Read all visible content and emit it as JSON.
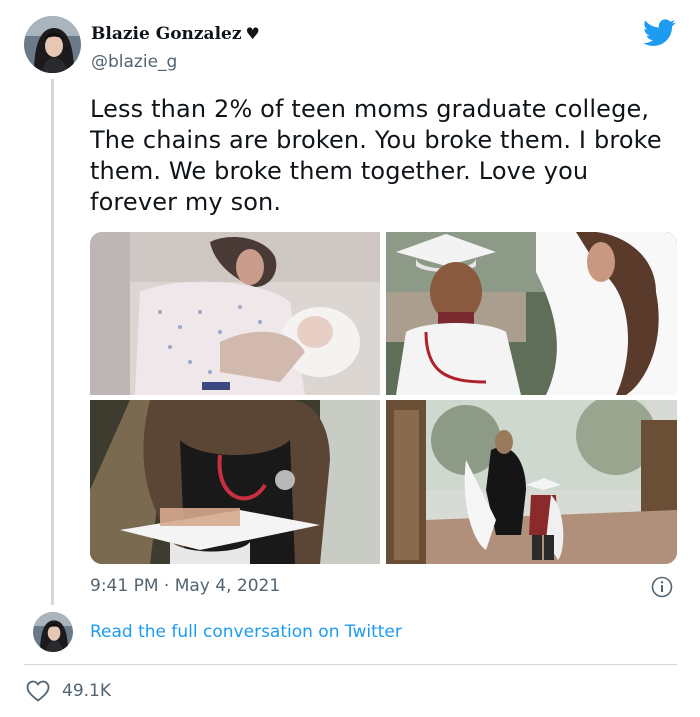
{
  "author": {
    "display_name": "Blazie Gonzalez",
    "name_suffix": "♥",
    "handle": "@blazie_g",
    "avatar_icon": "profile-photo"
  },
  "tweet": {
    "text": "Less than 2% of teen moms graduate college, The chains are broken. You broke them. I broke them. We broke them together. Love you forever my son.",
    "timestamp": "9:41 PM · May 4, 2021",
    "media": [
      {
        "name": "hospital-newborn-photo"
      },
      {
        "name": "child-graduation-cap-photo"
      },
      {
        "name": "stethoscope-graduation-cap-photo"
      },
      {
        "name": "mother-son-walking-photo"
      }
    ]
  },
  "conversation": {
    "link_text": "Read the full conversation on Twitter"
  },
  "engagement": {
    "likes": "49.1K"
  },
  "icons": {
    "brand": "twitter-bird-icon",
    "info": "info-icon",
    "like": "heart-icon"
  },
  "colors": {
    "twitter_blue": "#1d9bf0",
    "secondary_text": "#536471",
    "primary_text": "#0f1419",
    "border": "#cfd9de"
  }
}
